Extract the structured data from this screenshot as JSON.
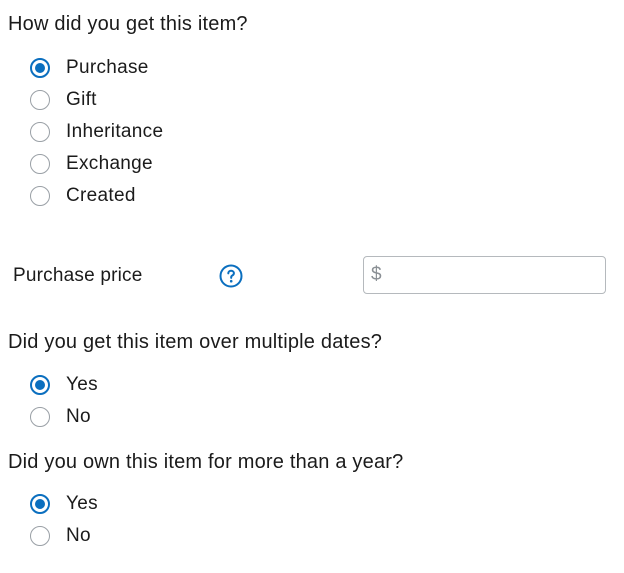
{
  "acquisition": {
    "question": "How did you get this item?",
    "options": [
      {
        "label": "Purchase",
        "selected": true
      },
      {
        "label": "Gift",
        "selected": false
      },
      {
        "label": "Inheritance",
        "selected": false
      },
      {
        "label": "Exchange",
        "selected": false
      },
      {
        "label": "Created",
        "selected": false
      }
    ]
  },
  "purchase_price": {
    "label": "Purchase price",
    "help_icon": "question-circle-icon",
    "currency_symbol": "$",
    "value": "",
    "placeholder": ""
  },
  "multiple_dates": {
    "question": "Did you get this item over multiple dates?",
    "options": [
      {
        "label": "Yes",
        "selected": true
      },
      {
        "label": "No",
        "selected": false
      }
    ]
  },
  "owned_over_year": {
    "question": "Did you own this item for more than a year?",
    "options": [
      {
        "label": "Yes",
        "selected": true
      },
      {
        "label": "No",
        "selected": false
      }
    ]
  },
  "colors": {
    "accent": "#0b6fbf",
    "text": "#1b1b1b",
    "radio_border": "#9aa0a6",
    "input_border": "#b5b9bd"
  }
}
